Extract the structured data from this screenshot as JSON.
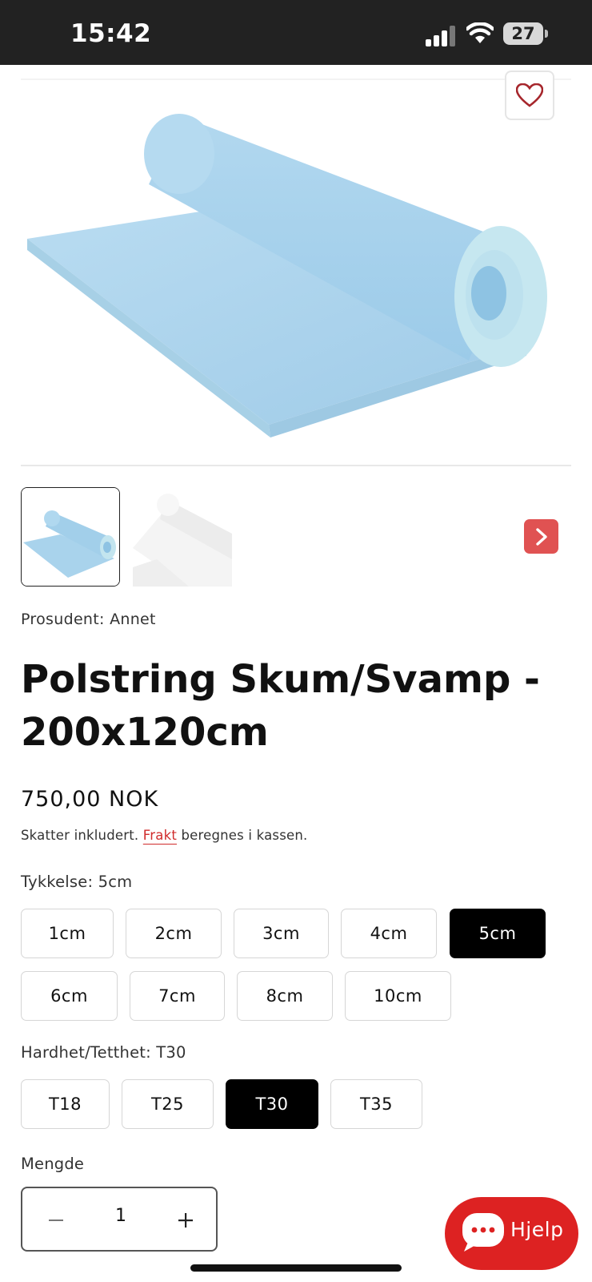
{
  "status_bar": {
    "time": "15:42",
    "battery": "27"
  },
  "product": {
    "vendor": "Prosudent: Annet",
    "title": "Polstring Skum/Svamp - 200x120cm",
    "price": "750,00 NOK",
    "tax_prefix": "Skatter inkludert.",
    "shipping_link": "Frakt",
    "tax_suffix": "beregnes i kassen."
  },
  "thickness": {
    "label": "Tykkelse: 5cm",
    "options": [
      "1cm",
      "2cm",
      "3cm",
      "4cm",
      "5cm",
      "6cm",
      "7cm",
      "8cm",
      "10cm"
    ],
    "selected": "5cm"
  },
  "hardness": {
    "label": "Hardhet/Tetthet: T30",
    "options": [
      "T18",
      "T25",
      "T30",
      "T35"
    ],
    "selected": "T30"
  },
  "quantity": {
    "label": "Mengde",
    "value": "1"
  },
  "help": {
    "label": "Hjelp"
  },
  "colors": {
    "accent": "#dd2222",
    "selected_bg": "#000000",
    "foam_blue": "#a9d3ec"
  },
  "icons": [
    "signal-icon",
    "wifi-icon",
    "battery-icon",
    "heart-icon",
    "chevron-right-icon",
    "minus-icon",
    "plus-icon",
    "chat-icon"
  ]
}
